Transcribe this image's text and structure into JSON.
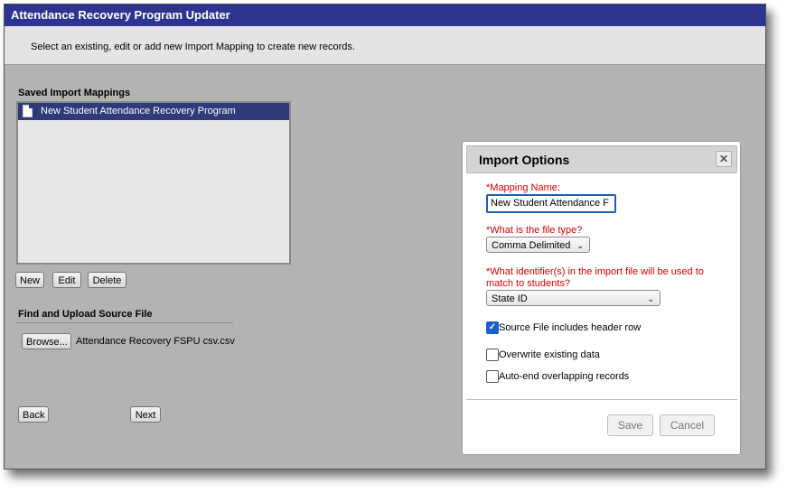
{
  "window": {
    "title": "Attendance Recovery Program Updater"
  },
  "instructions": "Select an existing, edit or add new Import Mapping to create new records.",
  "saved_mappings": {
    "label": "Saved Import Mappings",
    "items": [
      {
        "label": "New Student Attendance Recovery Program",
        "icon": "document-icon"
      }
    ]
  },
  "mapping_buttons": {
    "new": "New",
    "edit": "Edit",
    "delete": "Delete"
  },
  "upload": {
    "label": "Find and Upload Source File",
    "browse": "Browse...",
    "file_name": "Attendance Recovery FSPU csv.csv"
  },
  "nav": {
    "back": "Back",
    "next": "Next"
  },
  "modal": {
    "title": "Import Options",
    "close_icon": "close-icon",
    "mapping_name_label": "*Mapping Name:",
    "mapping_name_value": "New Student Attendance F",
    "file_type_label": "*What is the file type?",
    "file_type_value": "Comma Delimited",
    "identifier_label": "*What identifier(s) in the import file will be used to match to students?",
    "identifier_value": "State ID",
    "options": [
      {
        "label": "Source File includes header row",
        "checked": true
      },
      {
        "label": "Overwrite existing data",
        "checked": false
      },
      {
        "label": "Auto-end overlapping records",
        "checked": false
      }
    ],
    "save": "Save",
    "cancel": "Cancel"
  },
  "colors": {
    "titlebar": "#2b3590",
    "selected_item": "#2e3a7a",
    "required": "#d40000",
    "checkbox": "#1a5fd0"
  }
}
